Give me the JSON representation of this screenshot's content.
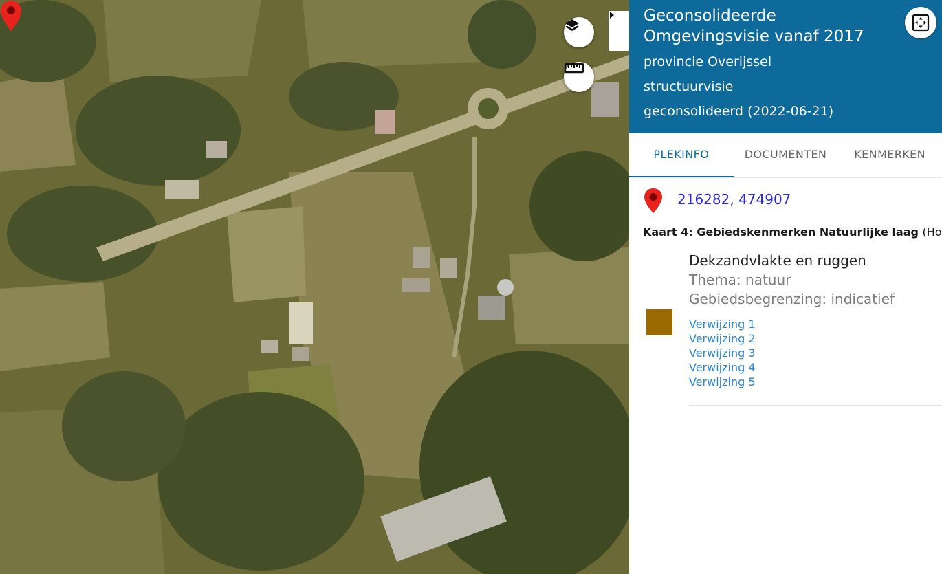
{
  "map": {
    "marker_icon": "map-marker-icon",
    "controls": {
      "layers_icon": "layers-icon",
      "measure_icon": "ruler-icon",
      "collapse_icon": "chevron-right-icon"
    }
  },
  "panel": {
    "title": "Geconsolideerde Omgevingsvisie vanaf 2017",
    "authority": "provincie Overijssel",
    "plan_type": "structuurvisie",
    "status": "geconsolideerd (2022-06-21)",
    "fullscreen_icon": "fullscreen-icon",
    "header_color": "#0f6a9c",
    "tabs": [
      {
        "label": "PLEKINFO",
        "active": true
      },
      {
        "label": "DOCUMENTEN",
        "active": false
      },
      {
        "label": "KENMERKEN",
        "active": false
      }
    ],
    "location": {
      "pin_icon": "location-pin-icon",
      "coordinates": "216282, 474907"
    },
    "map_title": "Kaart 4: Gebiedskenmerken Natuurlijke laag",
    "map_title_suffix": "(Hoe)",
    "feature": {
      "name": "Dekzandvlakte en ruggen",
      "theme": "Thema: natuur",
      "boundary": "Gebiedsbegrenzing: indicatief",
      "legend_color": "#9a6a00",
      "references": [
        "Verwijzing 1",
        "Verwijzing 2",
        "Verwijzing 3",
        "Verwijzing 4",
        "Verwijzing 5"
      ]
    }
  }
}
